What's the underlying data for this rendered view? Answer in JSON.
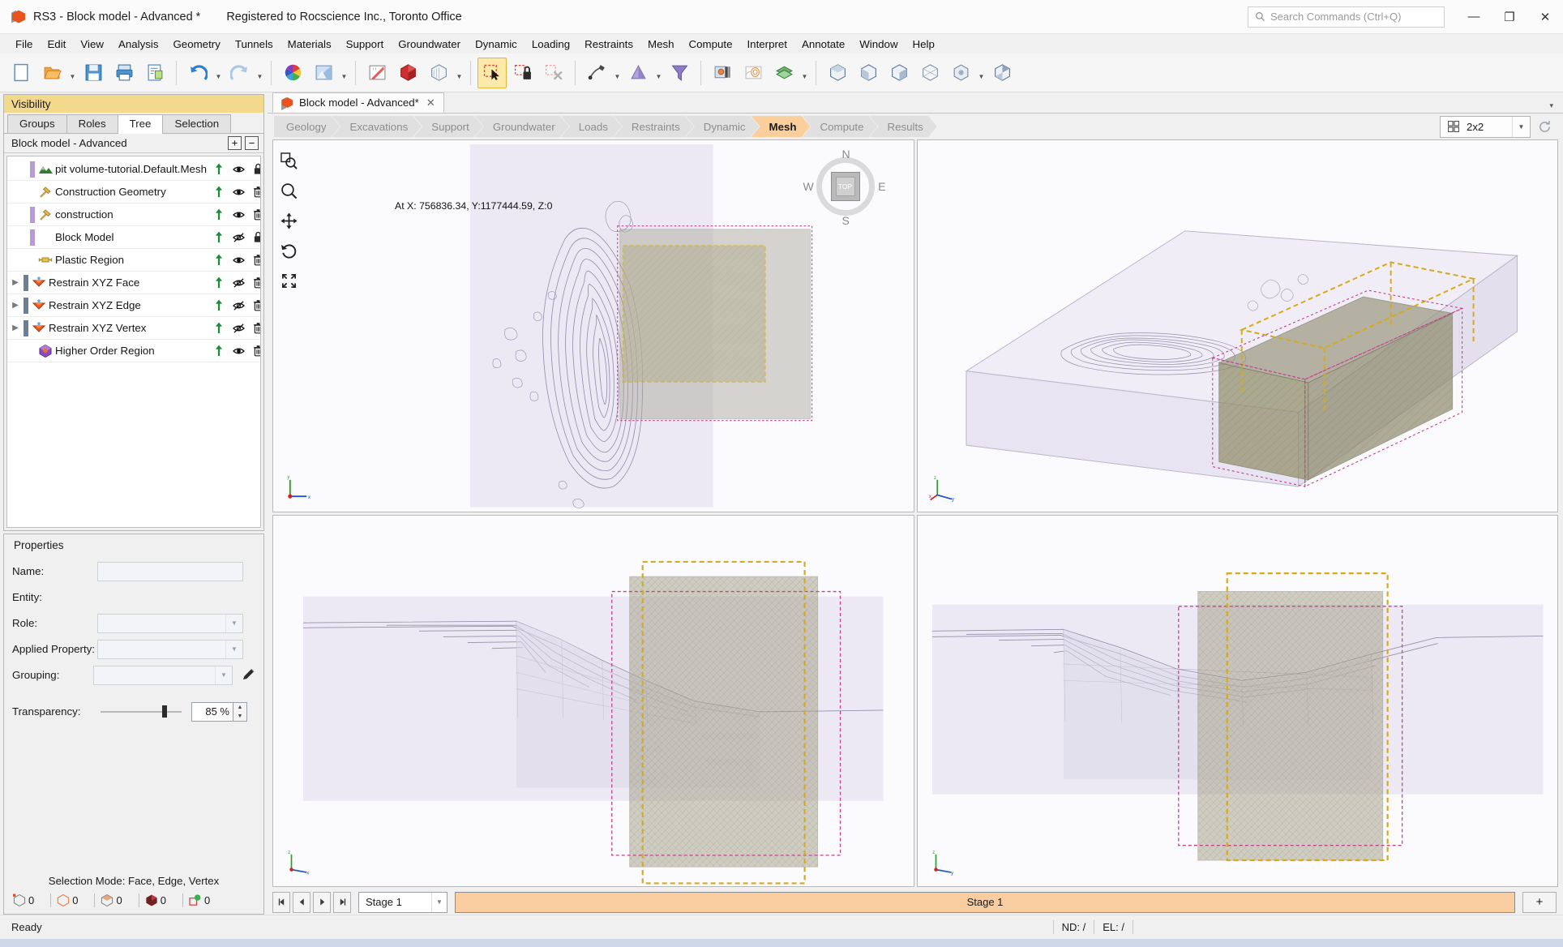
{
  "window": {
    "title": "RS3 - Block model - Advanced *",
    "registration": "Registered to Rocscience Inc., Toronto Office",
    "app_icon": "rs3-cube-icon",
    "minimize": "—",
    "maximize": "❐",
    "close": "✕"
  },
  "search": {
    "placeholder": "Search Commands (Ctrl+Q)",
    "icon": "search-icon"
  },
  "menu": {
    "items": [
      "File",
      "Edit",
      "View",
      "Analysis",
      "Geometry",
      "Tunnels",
      "Materials",
      "Support",
      "Groundwater",
      "Dynamic",
      "Loading",
      "Restraints",
      "Mesh",
      "Compute",
      "Interpret",
      "Annotate",
      "Window",
      "Help"
    ]
  },
  "toolbar": {
    "groups": [
      {
        "buttons": [
          {
            "name": "new-file-button",
            "icon": "new-document-icon",
            "active": false,
            "caret": false
          },
          {
            "name": "open-file-button",
            "icon": "open-folder-icon",
            "active": false,
            "caret": true
          },
          {
            "name": "save-button",
            "icon": "save-disk-icon",
            "active": false,
            "caret": false
          },
          {
            "name": "print-button",
            "icon": "printer-icon",
            "active": false,
            "caret": false
          },
          {
            "name": "report-button",
            "icon": "report-icon",
            "active": false,
            "caret": false
          }
        ]
      },
      {
        "buttons": [
          {
            "name": "undo-button",
            "icon": "undo-arrow-icon",
            "active": false,
            "caret": true
          },
          {
            "name": "redo-button",
            "icon": "redo-arrow-icon",
            "active": false,
            "caret": true
          }
        ]
      },
      {
        "buttons": [
          {
            "name": "color-wheel-button",
            "icon": "color-wheel-icon",
            "active": false,
            "caret": false
          },
          {
            "name": "display-options-button",
            "icon": "display-options-icon",
            "active": false,
            "caret": true
          }
        ]
      },
      {
        "buttons": [
          {
            "name": "measure-button",
            "icon": "ruler-icon",
            "active": false,
            "caret": false
          },
          {
            "name": "solid-volume-button",
            "icon": "red-solid-icon",
            "active": false,
            "caret": false
          },
          {
            "name": "wireframe-button",
            "icon": "wireframe-cube-icon",
            "active": false,
            "caret": true
          }
        ]
      },
      {
        "buttons": [
          {
            "name": "select-all-button",
            "icon": "select-cursor-icon",
            "active": true,
            "caret": false
          },
          {
            "name": "lock-selection-button",
            "icon": "lock-selection-icon",
            "active": false,
            "caret": false
          },
          {
            "name": "clear-selection-button",
            "icon": "clear-selection-icon",
            "active": false,
            "caret": false
          }
        ]
      },
      {
        "buttons": [
          {
            "name": "bolt-button",
            "icon": "bolt-icon",
            "active": false,
            "caret": true
          },
          {
            "name": "liner-button",
            "icon": "liner-cone-icon",
            "active": false,
            "caret": true
          },
          {
            "name": "joint-button",
            "icon": "joint-funnel-icon",
            "active": false,
            "caret": false
          }
        ]
      },
      {
        "buttons": [
          {
            "name": "material-zone-button",
            "icon": "material-zone-icon",
            "active": false,
            "caret": false
          },
          {
            "name": "contour-button",
            "icon": "contour-icon",
            "active": false,
            "caret": false
          },
          {
            "name": "layers-button",
            "icon": "layers-icon",
            "active": false,
            "caret": true
          }
        ]
      },
      {
        "buttons": [
          {
            "name": "mesh-cube-a-button",
            "icon": "mesh-cube-a-icon",
            "active": false,
            "caret": false
          },
          {
            "name": "mesh-cube-b-button",
            "icon": "mesh-cube-b-icon",
            "active": false,
            "caret": false
          },
          {
            "name": "mesh-cube-c-button",
            "icon": "mesh-cube-c-icon",
            "active": false,
            "caret": false
          },
          {
            "name": "mesh-cube-d-button",
            "icon": "mesh-cube-d-icon",
            "active": false,
            "caret": false
          },
          {
            "name": "mesh-cube-e-button",
            "icon": "mesh-cube-e-icon",
            "active": false,
            "caret": true
          },
          {
            "name": "mesh-cube-f-button",
            "icon": "mesh-cube-f-icon",
            "active": false,
            "caret": false
          }
        ]
      }
    ]
  },
  "visibility_panel": {
    "title": "Visibility",
    "tabs": [
      {
        "label": "Groups",
        "active": false
      },
      {
        "label": "Roles",
        "active": false
      },
      {
        "label": "Tree",
        "active": true
      },
      {
        "label": "Selection",
        "active": false
      }
    ],
    "tree_header": {
      "label": "Block model - Advanced",
      "expand_all": "⊕",
      "collapse_all": "⊖"
    },
    "tree_items": [
      {
        "label": "pit volume-tutorial.Default.Mesh",
        "icon": "terrain-mesh-icon",
        "twist": false,
        "color_bar": "#b79bd4",
        "visible": true,
        "locked": true,
        "indent": 1
      },
      {
        "label": "Construction Geometry",
        "icon": "hammer-icon",
        "twist": false,
        "color_bar": "",
        "visible": true,
        "locked": false,
        "indent": 1
      },
      {
        "label": "construction",
        "icon": "hammer-icon",
        "twist": false,
        "color_bar": "#b79bd4",
        "visible": true,
        "locked": false,
        "indent": 1
      },
      {
        "label": "Block Model",
        "icon": "",
        "twist": false,
        "color_bar": "#b79bd4",
        "visible": false,
        "locked": true,
        "indent": 1
      },
      {
        "label": "Plastic Region",
        "icon": "plastic-region-icon",
        "twist": false,
        "color_bar": "",
        "visible": true,
        "locked": false,
        "indent": 1
      },
      {
        "label": "Restrain XYZ Face",
        "icon": "restraint-icon",
        "twist": true,
        "color_bar": "#6f7f93",
        "visible": false,
        "locked": false,
        "indent": 0
      },
      {
        "label": "Restrain XYZ Edge",
        "icon": "restraint-icon",
        "twist": true,
        "color_bar": "#6f7f93",
        "visible": false,
        "locked": false,
        "indent": 0
      },
      {
        "label": "Restrain XYZ Vertex",
        "icon": "restraint-icon",
        "twist": true,
        "color_bar": "#6f7f93",
        "visible": false,
        "locked": false,
        "indent": 0
      },
      {
        "label": "Higher Order Region",
        "icon": "higher-order-icon",
        "twist": false,
        "color_bar": "",
        "visible": true,
        "locked": false,
        "indent": 1
      }
    ]
  },
  "properties": {
    "title": "Properties",
    "fields": [
      {
        "label": "Name:",
        "value": "",
        "type": "text",
        "name": "name-field"
      },
      {
        "label": "Entity:",
        "value": "",
        "type": "static",
        "name": "entity-value"
      },
      {
        "label": "Role:",
        "value": "",
        "type": "combo",
        "name": "role-combo"
      },
      {
        "label": "Applied Property:",
        "value": "",
        "type": "combo",
        "name": "applied-property-combo"
      },
      {
        "label": "Grouping:",
        "value": "",
        "type": "combo",
        "name": "grouping-combo"
      }
    ],
    "transparency": {
      "label": "Transparency:",
      "value": "85 %",
      "percent": 85
    },
    "selection_mode": "Selection Mode: Face, Edge, Vertex",
    "counters": [
      {
        "icon": "vertex-count-icon",
        "value": "0",
        "name": "vertex-counter"
      },
      {
        "icon": "edge-count-icon",
        "value": "0",
        "name": "edge-counter"
      },
      {
        "icon": "face-count-icon",
        "value": "0",
        "name": "face-counter"
      },
      {
        "icon": "solid-count-icon",
        "value": "0",
        "name": "solid-counter"
      },
      {
        "icon": "node-count-icon",
        "value": "0",
        "name": "node-counter"
      }
    ]
  },
  "document": {
    "tab": {
      "label": "Block model - Advanced*",
      "close": "✕",
      "icon": "rs3-cube-icon"
    },
    "expander": "▾"
  },
  "workflow": {
    "steps": [
      {
        "label": "Geology",
        "active": false
      },
      {
        "label": "Excavations",
        "active": false
      },
      {
        "label": "Support",
        "active": false
      },
      {
        "label": "Groundwater",
        "active": false
      },
      {
        "label": "Loads",
        "active": false
      },
      {
        "label": "Restraints",
        "active": false
      },
      {
        "label": "Dynamic",
        "active": false
      },
      {
        "label": "Mesh",
        "active": true
      },
      {
        "label": "Compute",
        "active": false
      },
      {
        "label": "Results",
        "active": false
      }
    ]
  },
  "layout_selector": {
    "value": "2x2",
    "icon": "grid-2x2-icon",
    "refresh": "refresh-icon"
  },
  "viewports": [
    {
      "name": "viewport-top",
      "orientation": "TOP",
      "coordinate_readout": "At X: 756836.34, Y:1177444.59, Z:0",
      "compass": {
        "n": "N",
        "s": "S",
        "e": "E",
        "w": "W",
        "face": "TOP"
      },
      "nav_tools": [
        {
          "name": "zoom-window-tool",
          "icon": "zoom-window-icon"
        },
        {
          "name": "zoom-tool",
          "icon": "magnifier-icon"
        },
        {
          "name": "pan-tool",
          "icon": "pan-move-icon"
        },
        {
          "name": "rotate-tool",
          "icon": "rotate-icon"
        },
        {
          "name": "zoom-extents-tool",
          "icon": "zoom-extents-icon"
        }
      ],
      "axes": [
        "x",
        "y"
      ]
    },
    {
      "name": "viewport-iso",
      "orientation": "ISO",
      "axes": [
        "x",
        "y",
        "z"
      ]
    },
    {
      "name": "viewport-front",
      "orientation": "FRONT",
      "axes": [
        "x",
        "y",
        "z"
      ]
    },
    {
      "name": "viewport-side",
      "orientation": "SIDE",
      "axes": [
        "x",
        "y",
        "z"
      ]
    }
  ],
  "stage_bar": {
    "first": "⏮",
    "prev": "◀",
    "next": "▶",
    "last": "⏭",
    "stage_value": "Stage 1",
    "track_label": "Stage 1",
    "add": "+"
  },
  "status_bar": {
    "message": "Ready",
    "nd": "ND: /",
    "el": "EL: /"
  },
  "colors": {
    "accent_orange": "#fbcf9b",
    "panel_yellow": "#f2d98c",
    "viewport_bg": "#fbfafd",
    "selection_yellow": "#d2b03a",
    "mesh_magenta": "#c04a9a",
    "block_olive": "#a8a882"
  }
}
